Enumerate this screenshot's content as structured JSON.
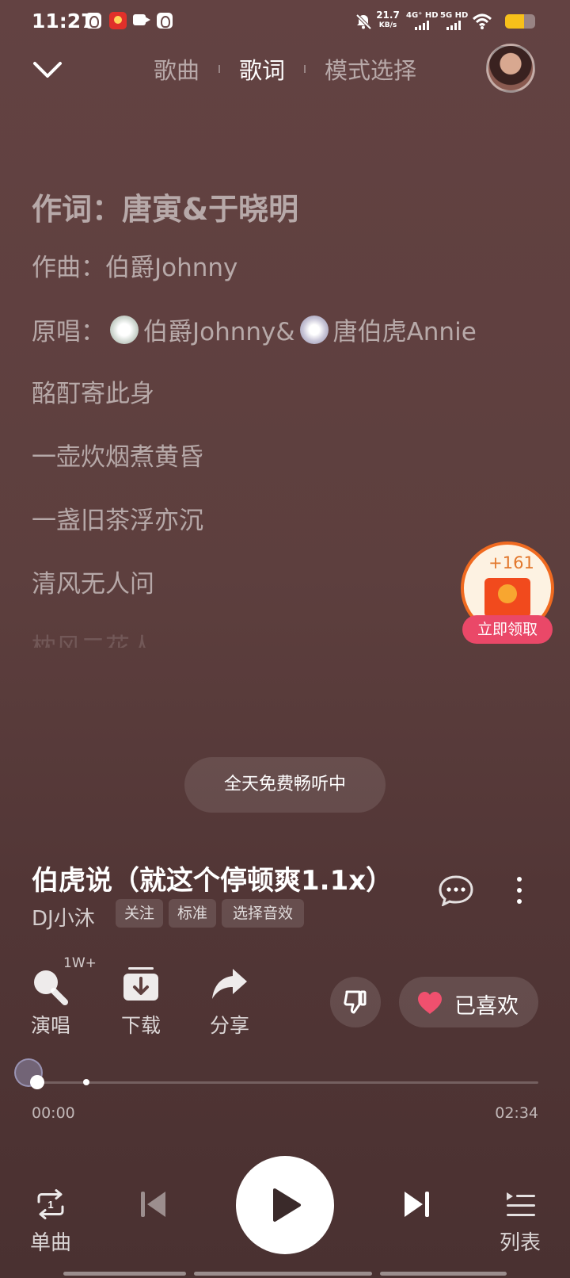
{
  "status_bar": {
    "time": "11:27",
    "speed_value": "21.7",
    "speed_unit": "KB/s",
    "network1": "4G⁺ HD",
    "network2": "5G HD"
  },
  "header": {
    "tabs": [
      "歌曲",
      "歌词",
      "模式选择"
    ],
    "active_tab": "歌词"
  },
  "lyrics": {
    "lyricist": "作词：唐寅&于晓明",
    "composer": "作曲：伯爵Johnny",
    "singers_prefix": "原唱：",
    "singer1": "伯爵Johnny&",
    "singer2": "唐伯虎Annie",
    "lines": [
      "酩酊寄此身",
      "一壶炊烟煮黄昏",
      "一盏旧茶浮亦沉",
      "清风无人问",
      "枕风二花人"
    ]
  },
  "reward": {
    "amount": "+161",
    "button": "立即领取"
  },
  "free_pill": "全天免费畅听中",
  "song": {
    "title": "伯虎说（就这个停顿爽1.1x）",
    "artist": "DJ小沐",
    "chips": [
      "关注",
      "标准",
      "选择音效"
    ]
  },
  "actions": {
    "sing": "演唱",
    "sing_badge": "1W+",
    "download": "下载",
    "share": "分享",
    "liked": "已喜欢"
  },
  "progress": {
    "current": "00:00",
    "total": "02:34",
    "played_fraction": 0.0
  },
  "controls": {
    "mode": "单曲",
    "playlist": "列表"
  },
  "colors": {
    "background": "#5d3f3e",
    "like_heart": "#f0506e",
    "reward_button": "#ea4868",
    "battery": "#f7c01a"
  }
}
